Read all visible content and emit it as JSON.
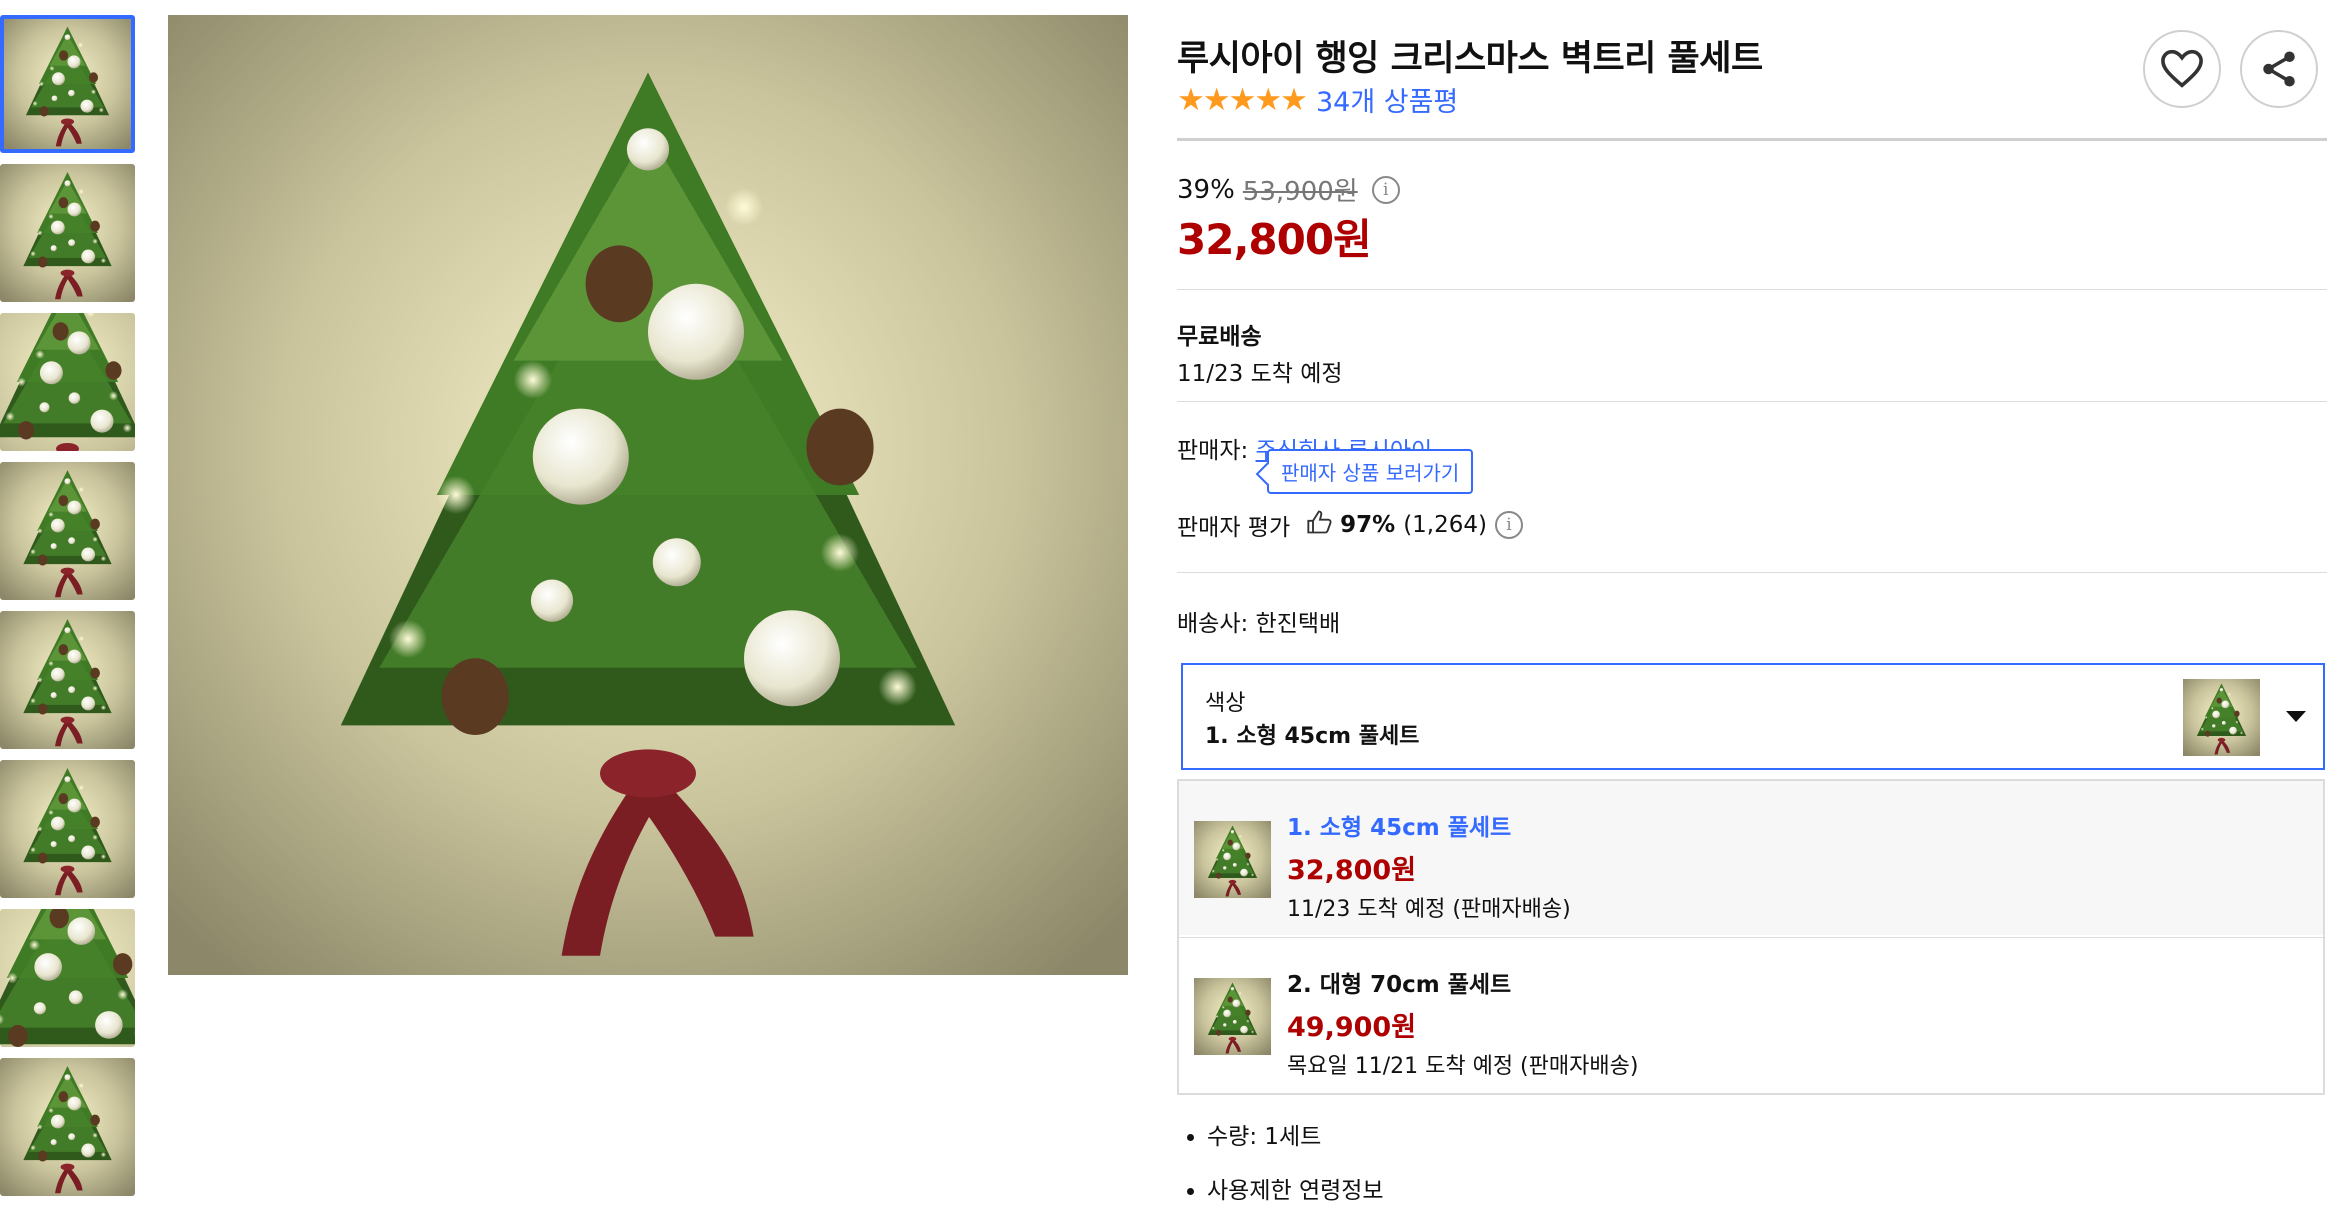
{
  "product": {
    "title": "루시아이 행잉 크리스마스 벽트리 풀세트",
    "rating_stars": "★★★★★",
    "review_count": "34개 상품평",
    "discount_rate": "39%",
    "original_price": "53,900원",
    "sale_price": "32,800원",
    "info_icon": "i",
    "star_color": "#ff9a1e",
    "link_color": "#346aff",
    "price_color": "#ae0000"
  },
  "actions": {
    "wishlist_icon": "heart-icon",
    "share_icon": "share-icon"
  },
  "shipping": {
    "title": "무료배송",
    "date": "11/23 도착 예정"
  },
  "seller": {
    "label": "판매자: ",
    "name": "주식회사 루시아이",
    "tooltip": "판매자 상품 보러가기",
    "rating_label": "판매자 평가",
    "rating_pct": "97%",
    "rating_count": "(1,264)",
    "rating_info_icon": "i"
  },
  "courier": "배송사: 한진택배",
  "option": {
    "label": "색상",
    "value": "1. 소형 45cm 풀세트",
    "items": [
      {
        "name": "1. 소형 45cm 풀세트",
        "price": "32,800원",
        "delivery": "11/23 도착 예정 (판매자배송)"
      },
      {
        "name": "2. 대형 70cm 풀세트",
        "price": "49,900원",
        "delivery": "목요일 11/21 도착 예정 (판매자배송)"
      }
    ]
  },
  "details": [
    "수량: 1세트",
    "사용제한 연령정보"
  ],
  "thumbnails_count": 8
}
